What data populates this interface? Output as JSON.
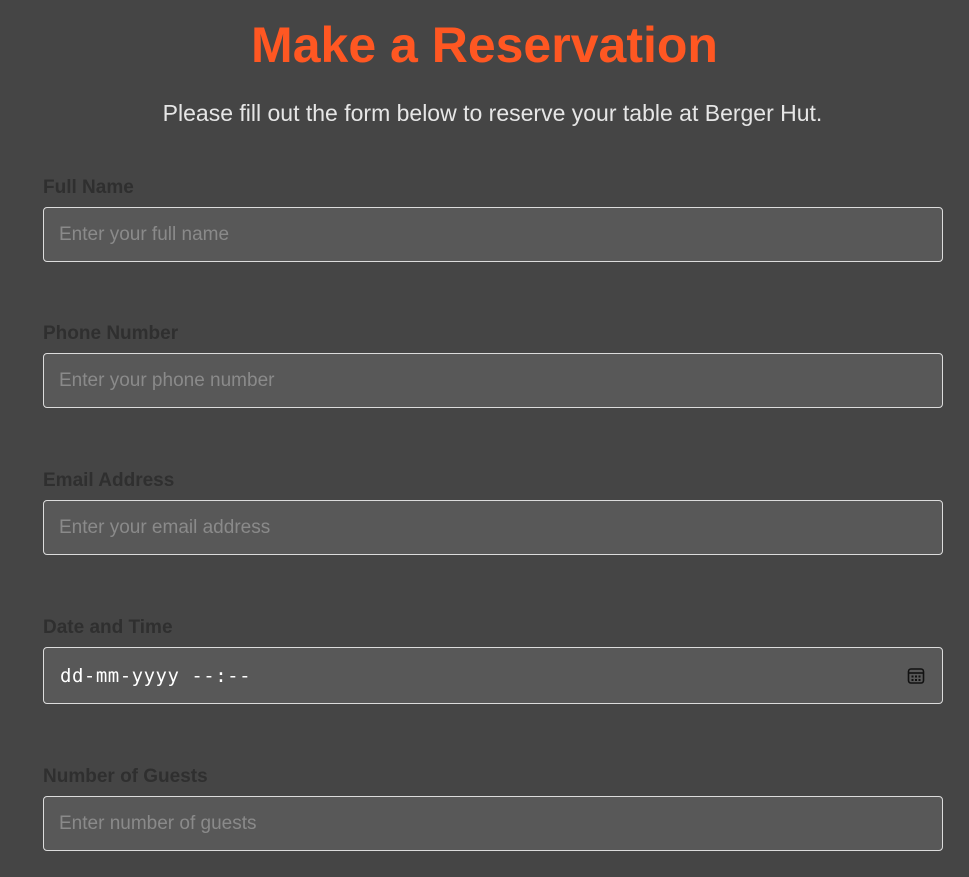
{
  "page": {
    "title": "Make a Reservation",
    "subtitle": "Please fill out the form below to reserve your table at Berger Hut."
  },
  "form": {
    "full_name": {
      "label": "Full Name",
      "placeholder": "Enter your full name",
      "value": ""
    },
    "phone": {
      "label": "Phone Number",
      "placeholder": "Enter your phone number",
      "value": ""
    },
    "email": {
      "label": "Email Address",
      "placeholder": "Enter your email address",
      "value": ""
    },
    "datetime": {
      "label": "Date and Time",
      "display_value": "dd-mm-yyyy --:--",
      "icon": "calendar-icon"
    },
    "guests": {
      "label": "Number of Guests",
      "placeholder": "Enter number of guests",
      "value": ""
    }
  },
  "colors": {
    "background": "#454545",
    "accent": "#ff5722",
    "field_background": "#585858",
    "field_border": "#dcdcdc",
    "label": "#2f2f2f"
  }
}
